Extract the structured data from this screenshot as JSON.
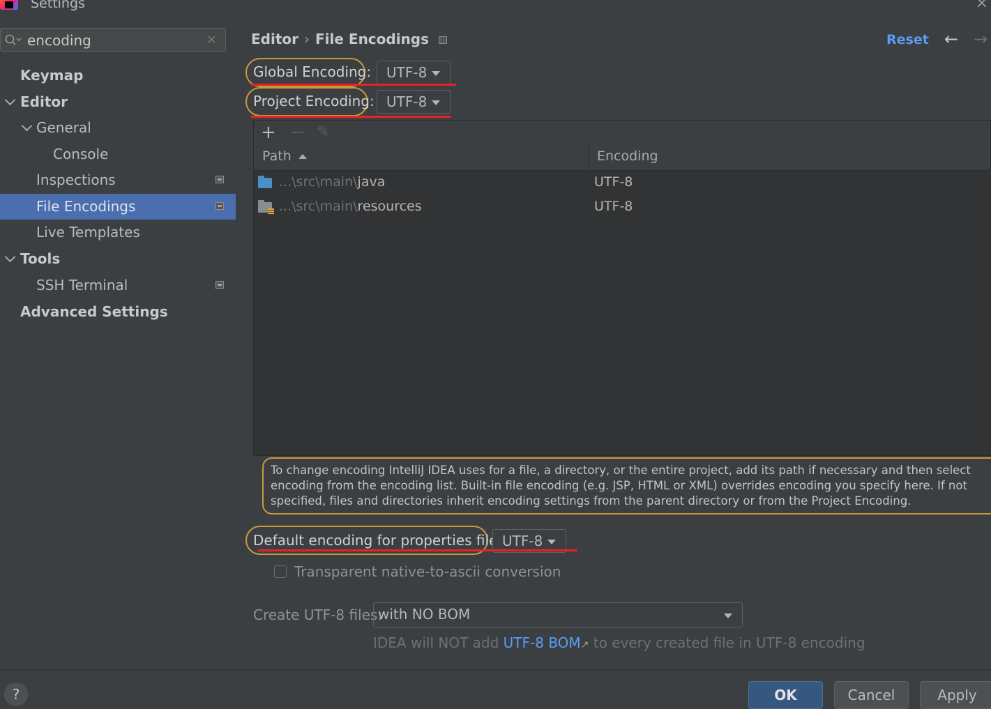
{
  "window": {
    "title": "Settings"
  },
  "search": {
    "value": "encoding"
  },
  "sidebar": {
    "items": [
      {
        "label": "Keymap"
      },
      {
        "label": "Editor"
      },
      {
        "label": "General"
      },
      {
        "label": "Console"
      },
      {
        "label": "Inspections"
      },
      {
        "label": "File Encodings"
      },
      {
        "label": "Live Templates"
      },
      {
        "label": "Tools"
      },
      {
        "label": "SSH Terminal"
      },
      {
        "label": "Advanced Settings"
      }
    ]
  },
  "header": {
    "breadcrumb": [
      "Editor",
      "File Encodings"
    ],
    "breadcrumb_sep": "›",
    "reset_label": "Reset",
    "back_icon": "←",
    "forward_icon": "→"
  },
  "encodings": {
    "global_label": "Global Encoding:",
    "global_value": "UTF-8",
    "project_label": "Project Encoding:",
    "project_value": "UTF-8"
  },
  "table": {
    "toolbar": {
      "add": "+",
      "remove": "−",
      "edit": "✎"
    },
    "columns": [
      "Path",
      "Encoding"
    ],
    "rows": [
      {
        "path_prefix": "...\\src\\main\\",
        "path_name": "java",
        "encoding": "UTF-8"
      },
      {
        "path_prefix": "...\\src\\main\\",
        "path_name": "resources",
        "encoding": "UTF-8"
      }
    ]
  },
  "info_text": "To change encoding IntelliJ IDEA uses for a file, a directory, or the entire project, add its path if necessary and then select encoding from the encoding list. Built-in file encoding (e.g. JSP, HTML or XML) overrides encoding you specify here. If not specified, files and directories inherit encoding settings from the parent directory or from the Project Encoding.",
  "properties": {
    "label": "Default encoding for properties files:",
    "value": "UTF-8",
    "checkbox_label": "Transparent native-to-ascii conversion",
    "checkbox_checked": false
  },
  "bom": {
    "label": "Create UTF-8 files:",
    "value": "with NO BOM",
    "note_prefix": "IDEA will NOT add",
    "note_link": "UTF-8 BOM",
    "note_link_icon": "↗",
    "note_suffix": "to every created file in UTF-8 encoding"
  },
  "buttons": {
    "help": "?",
    "ok": "OK",
    "cancel": "Cancel",
    "apply": "Apply"
  },
  "close_icon": "×",
  "search_clear_icon": "×",
  "colors": {
    "accent": "#4b6eaf",
    "link": "#589df6",
    "highlight": "#c89a3b",
    "underline": "#e8222a"
  }
}
